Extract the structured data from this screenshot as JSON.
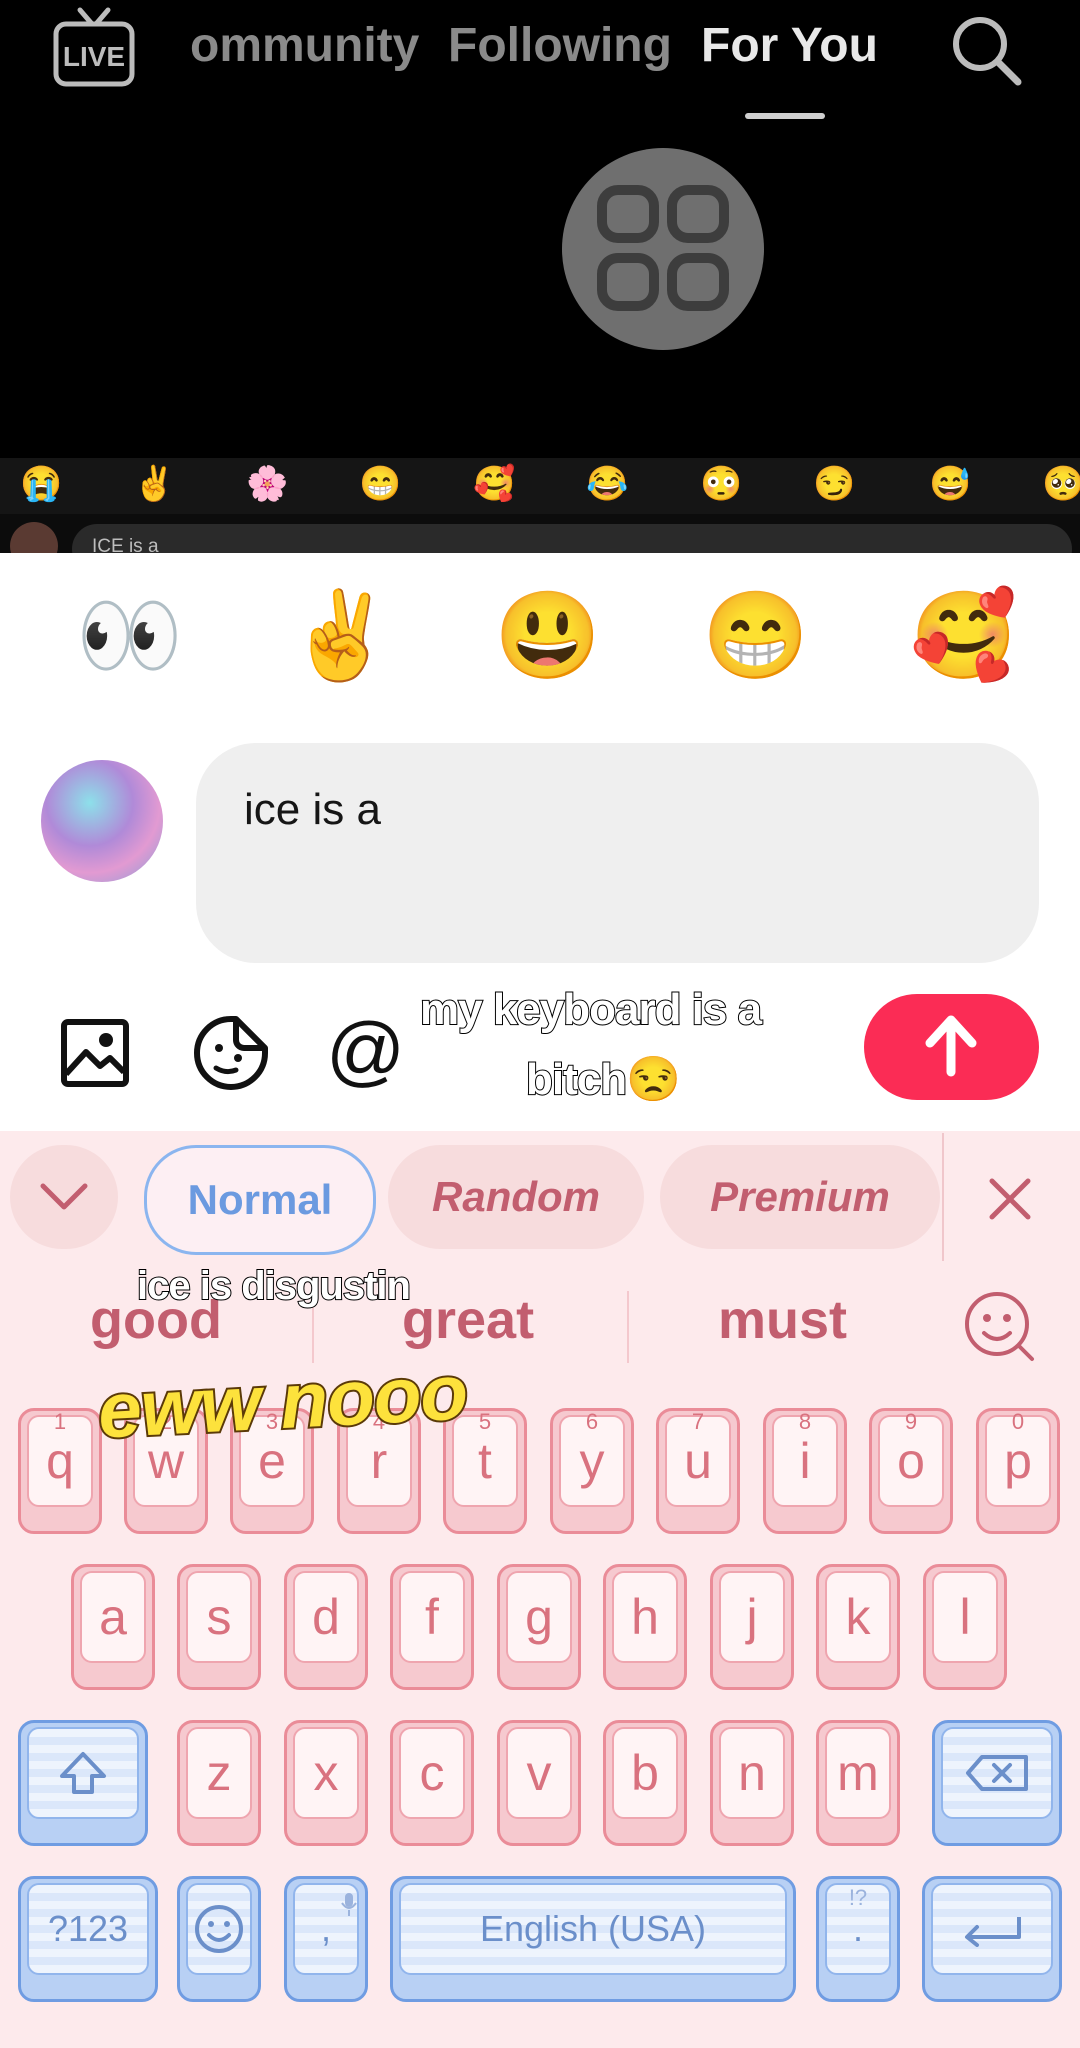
{
  "top_nav": {
    "tabs": [
      "ommunity",
      "Following",
      "For You"
    ],
    "live_label": "LIVE"
  },
  "emoji_strip": [
    "😭",
    "✌️",
    "🌸",
    "😁",
    "🥰",
    "😂",
    "😳",
    "😏",
    "😅",
    "🥺"
  ],
  "mini_comment": {
    "text": "ICE is a"
  },
  "quick_emojis": [
    "👀",
    "✌️",
    "😃",
    "😁",
    "🥰"
  ],
  "comment": {
    "text": "ice is a"
  },
  "captions": {
    "top_line1": "my keyboard is a",
    "top_line2": "bitch😒",
    "middle": "ice is disgustin",
    "bottom": "eww nooo"
  },
  "keyboard": {
    "modes": [
      "Normal",
      "Random",
      "Premium"
    ],
    "suggestions": [
      "good",
      "great",
      "must"
    ],
    "row1": [
      {
        "k": "q",
        "n": "1"
      },
      {
        "k": "w",
        "n": "2"
      },
      {
        "k": "e",
        "n": "3"
      },
      {
        "k": "r",
        "n": "4"
      },
      {
        "k": "t",
        "n": "5"
      },
      {
        "k": "y",
        "n": "6"
      },
      {
        "k": "u",
        "n": "7"
      },
      {
        "k": "i",
        "n": "8"
      },
      {
        "k": "o",
        "n": "9"
      },
      {
        "k": "p",
        "n": "0"
      }
    ],
    "row2": [
      "a",
      "s",
      "d",
      "f",
      "g",
      "h",
      "j",
      "k",
      "l"
    ],
    "row3": [
      "z",
      "x",
      "c",
      "v",
      "b",
      "n",
      "m"
    ],
    "symbols_key": "?123",
    "comma_key": ",",
    "space_label": "English (USA)",
    "period_key": ".",
    "period_alt": "!?"
  },
  "colors": {
    "send": "#fb2c55",
    "key_pink": "#f6c9cf",
    "key_blue": "#b8d0f4",
    "accent_text": "#c25e6f"
  }
}
